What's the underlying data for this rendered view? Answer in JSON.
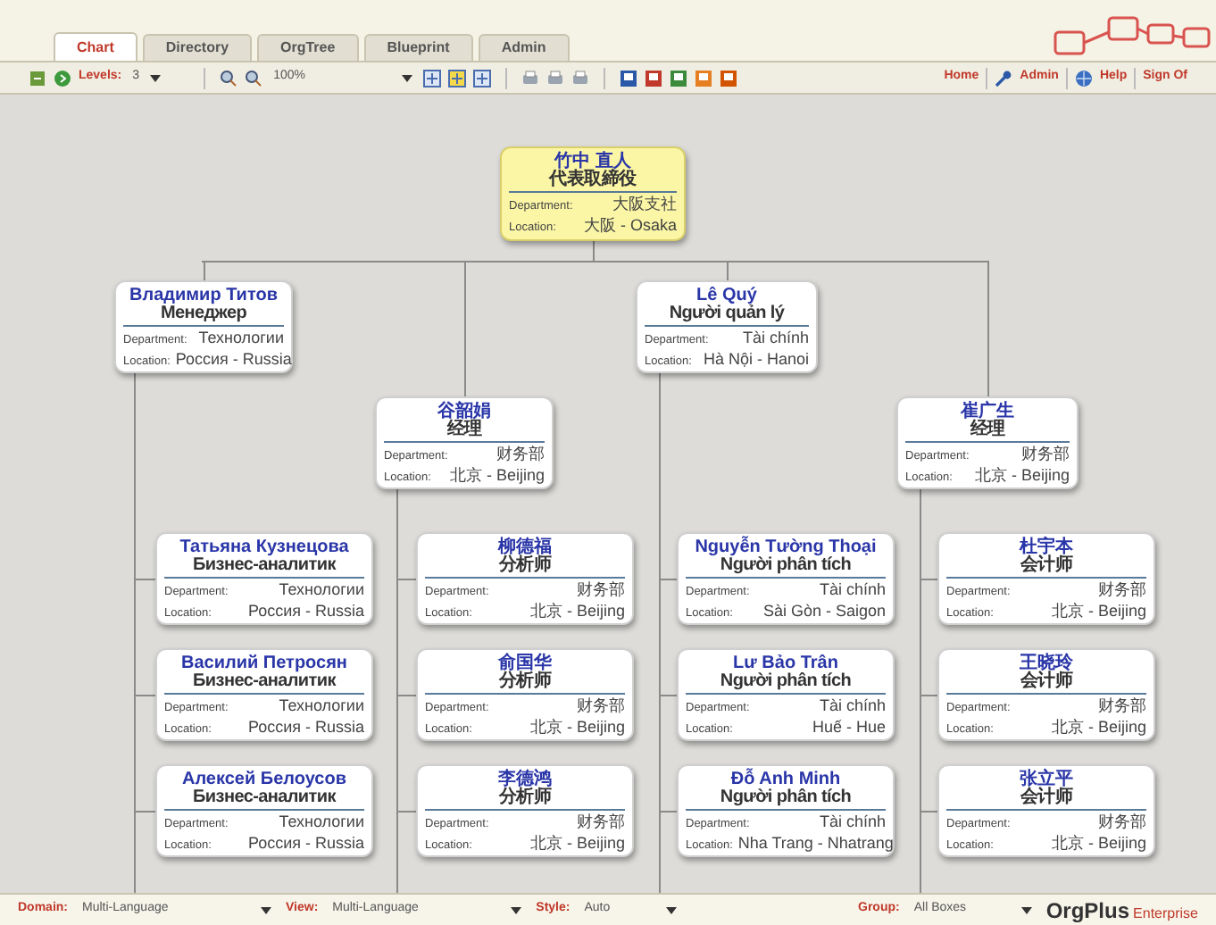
{
  "tabs": [
    {
      "label": "Chart",
      "selected": true
    },
    {
      "label": "Directory",
      "selected": false
    },
    {
      "label": "OrgTree",
      "selected": false
    },
    {
      "label": "Blueprint",
      "selected": false
    },
    {
      "label": "Admin",
      "selected": false
    }
  ],
  "toolbar": {
    "levels": {
      "label": "Levels:",
      "value": "3"
    },
    "zoom": {
      "value": "100%"
    },
    "links": [
      "Home",
      "Admin",
      "Help",
      "Sign Of"
    ]
  },
  "chart": {
    "root": {
      "name": "竹中 直人",
      "title": "代表取締役",
      "selected": true,
      "fields": [
        {
          "label": "Department:",
          "value": "大阪支社"
        },
        {
          "label": "Location:",
          "value": "大阪 - Osaka"
        }
      ],
      "children": [
        {
          "name": "Владимир Титов",
          "title": "Менеджер",
          "selected": false,
          "fields": [
            {
              "label": "Department:",
              "value": "Технологии"
            },
            {
              "label": "Location:",
              "value": "Россия - Russia"
            }
          ],
          "children": [
            {
              "name": "Татьяна Кузнецова",
              "title": "Бизнес-аналитик",
              "selected": false,
              "fields": [
                {
                  "label": "Department:",
                  "value": "Технологии"
                },
                {
                  "label": "Location:",
                  "value": "Россия - Russia"
                }
              ]
            },
            {
              "name": "Василий Петросян",
              "title": "Бизнес-аналитик",
              "selected": false,
              "fields": [
                {
                  "label": "Department:",
                  "value": "Технологии"
                },
                {
                  "label": "Location:",
                  "value": "Россия - Russia"
                }
              ]
            },
            {
              "name": "Алексей Белоусов",
              "title": "Бизнес-аналитик",
              "selected": false,
              "fields": [
                {
                  "label": "Department:",
                  "value": "Технологии"
                },
                {
                  "label": "Location:",
                  "value": "Россия - Russia"
                }
              ]
            }
          ]
        },
        {
          "name": "谷韶娟",
          "title": "经理",
          "selected": false,
          "fields": [
            {
              "label": "Department:",
              "value": "财务部"
            },
            {
              "label": "Location:",
              "value": "北京 - Beijing"
            }
          ],
          "children": [
            {
              "name": "柳德福",
              "title": "分析师",
              "selected": false,
              "fields": [
                {
                  "label": "Department:",
                  "value": "财务部"
                },
                {
                  "label": "Location:",
                  "value": "北京 - Beijing"
                }
              ]
            },
            {
              "name": "俞国华",
              "title": "分析师",
              "selected": false,
              "fields": [
                {
                  "label": "Department:",
                  "value": "财务部"
                },
                {
                  "label": "Location:",
                  "value": "北京 - Beijing"
                }
              ]
            },
            {
              "name": "李德鸿",
              "title": "分析师",
              "selected": false,
              "fields": [
                {
                  "label": "Department:",
                  "value": "财务部"
                },
                {
                  "label": "Location:",
                  "value": "北京 - Beijing"
                }
              ]
            }
          ]
        },
        {
          "name": "Lê Quý",
          "title": "Người quản lý",
          "selected": false,
          "fields": [
            {
              "label": "Department:",
              "value": "Tài chính"
            },
            {
              "label": "Location:",
              "value": "Hà Nội - Hanoi"
            }
          ],
          "children": [
            {
              "name": "Nguyễn Tường Thoại",
              "title": "Người phân tích",
              "selected": false,
              "fields": [
                {
                  "label": "Department:",
                  "value": "Tài chính"
                },
                {
                  "label": "Location:",
                  "value": "Sài Gòn - Saigon"
                }
              ]
            },
            {
              "name": "Lư Bảo Trân",
              "title": "Người phân tích",
              "selected": false,
              "fields": [
                {
                  "label": "Department:",
                  "value": "Tài chính"
                },
                {
                  "label": "Location:",
                  "value": "Huế - Hue"
                }
              ]
            },
            {
              "name": "Đỗ Anh Minh",
              "title": "Người phân tích",
              "selected": false,
              "fields": [
                {
                  "label": "Department:",
                  "value": "Tài chính"
                },
                {
                  "label": "Location:",
                  "value": "Nha Trang - Nhatrang"
                }
              ]
            }
          ]
        },
        {
          "name": "崔广生",
          "title": "经理",
          "selected": false,
          "fields": [
            {
              "label": "Department:",
              "value": "财务部"
            },
            {
              "label": "Location:",
              "value": "北京 - Beijing"
            }
          ],
          "children": [
            {
              "name": "杜宇本",
              "title": "会计师",
              "selected": false,
              "fields": [
                {
                  "label": "Department:",
                  "value": "财务部"
                },
                {
                  "label": "Location:",
                  "value": "北京 - Beijing"
                }
              ]
            },
            {
              "name": "王晓玲",
              "title": "会计师",
              "selected": false,
              "fields": [
                {
                  "label": "Department:",
                  "value": "财务部"
                },
                {
                  "label": "Location:",
                  "value": "北京 - Beijing"
                }
              ]
            },
            {
              "name": "张立平",
              "title": "会计师",
              "selected": false,
              "fields": [
                {
                  "label": "Department:",
                  "value": "财务部"
                },
                {
                  "label": "Location:",
                  "value": "北京 - Beijing"
                }
              ]
            }
          ]
        }
      ]
    }
  },
  "bottom_bar": {
    "selects": [
      {
        "label": "Domain:",
        "value": "Multi-Language"
      },
      {
        "label": "View:",
        "value": "Multi-Language"
      },
      {
        "label": "Style:",
        "value": "Auto"
      },
      {
        "label": "Group:",
        "value": "All Boxes"
      }
    ],
    "brand": "OrgPlus",
    "edition": "Enterprise"
  }
}
